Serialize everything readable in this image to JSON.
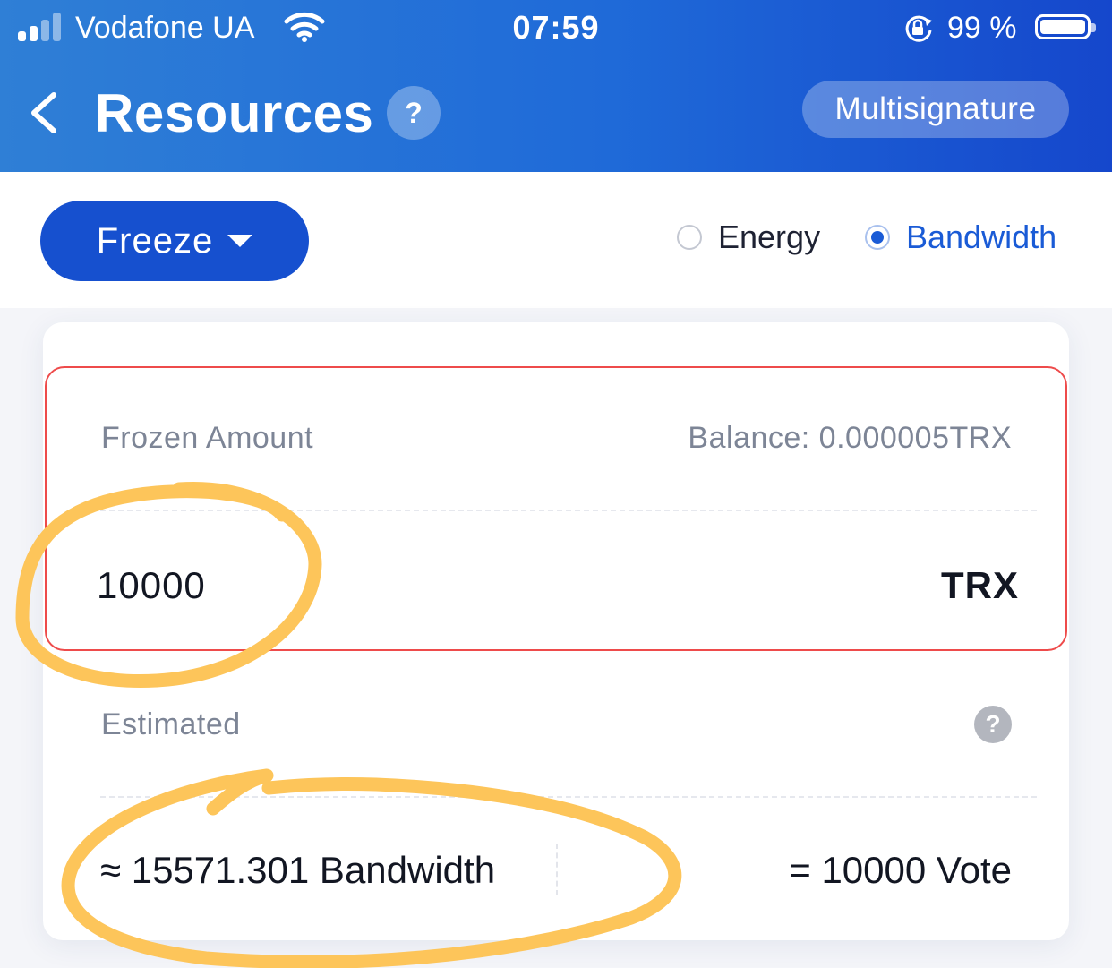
{
  "status_bar": {
    "carrier": "Vodafone UA",
    "time": "07:59",
    "battery_percent": "99 %",
    "battery_level": 0.99,
    "signal_bars": 2
  },
  "header": {
    "title": "Resources",
    "help_glyph": "?",
    "multisig_label": "Multisignature"
  },
  "controls": {
    "action_label": "Freeze",
    "resource_options": [
      {
        "label": "Energy",
        "selected": false
      },
      {
        "label": "Bandwidth",
        "selected": true
      }
    ]
  },
  "frozen": {
    "label": "Frozen Amount",
    "balance": "Balance: 0.000005TRX",
    "amount": "10000",
    "unit": "TRX"
  },
  "estimate": {
    "label": "Estimated",
    "help_glyph": "?",
    "bandwidth": "≈ 15571.301 Bandwidth",
    "votes": "= 10000 Vote"
  },
  "colors": {
    "header_start": "#2f7fd6",
    "header_end": "#1547cc",
    "primary": "#1650cf",
    "accent": "#1a5bd6",
    "error_border": "#ee4b4b",
    "highlight_marker": "#fdc55a"
  },
  "icons": {
    "back": "chevron-left-icon",
    "signal": "cellular-signal-icon",
    "wifi": "wifi-icon",
    "rotation_lock": "rotation-lock-icon",
    "battery": "battery-icon"
  }
}
